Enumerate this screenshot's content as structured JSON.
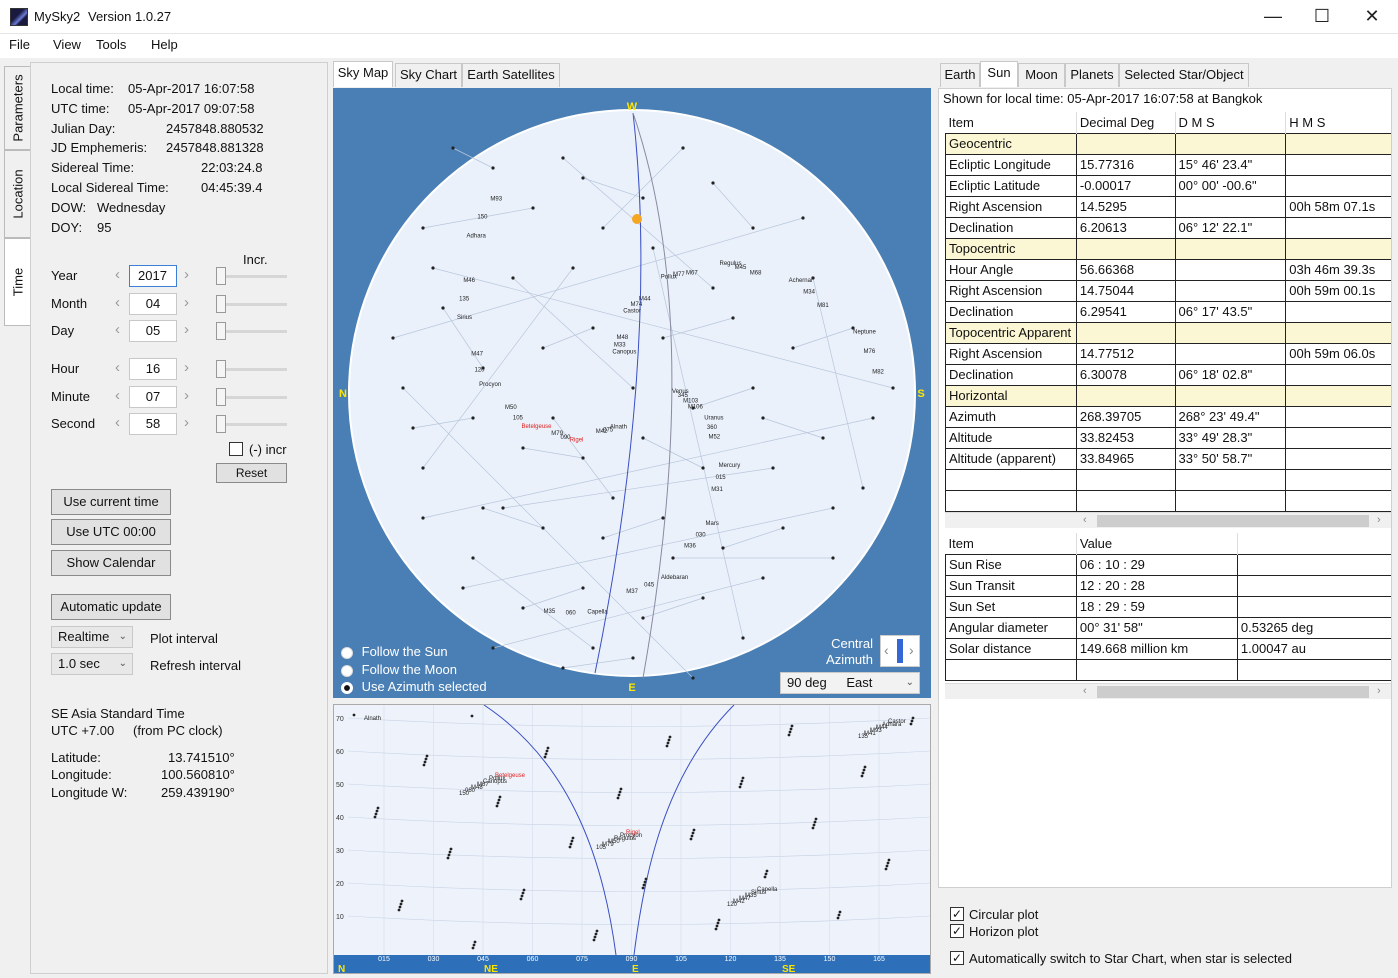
{
  "window": {
    "title": "MySky2",
    "version": "Version 1.0.27",
    "minimize_glyph": "—",
    "maximize_glyph": "☐",
    "close_glyph": "✕"
  },
  "menu": [
    "File",
    "View",
    "Tools",
    "Help"
  ],
  "left_tabs": [
    "Parameters",
    "Location",
    "Time"
  ],
  "time_info": [
    {
      "label": "Local time:",
      "value": "05-Apr-2017   16:07:58"
    },
    {
      "label": "UTC time:",
      "value": "05-Apr-2017   09:07:58"
    },
    {
      "label": "Julian Day:",
      "value": "2457848.880532"
    },
    {
      "label": "JD Emphemeris:",
      "value": "2457848.881328"
    },
    {
      "label": "Sidereal Time:",
      "value": "22:03:24.8"
    },
    {
      "label": "Local Sidereal Time:",
      "value": "04:45:39.4"
    },
    {
      "label": "DOW:",
      "value": "Wednesday"
    },
    {
      "label": "DOY:",
      "value": "95"
    }
  ],
  "incr_label": "Incr.",
  "spinners": [
    {
      "label": "Year",
      "value": "2017"
    },
    {
      "label": "Month",
      "value": "04"
    },
    {
      "label": "Day",
      "value": "05"
    },
    {
      "label": "Hour",
      "value": "16"
    },
    {
      "label": "Minute",
      "value": "07"
    },
    {
      "label": "Second",
      "value": "58"
    }
  ],
  "neg_incr_label": "(-) incr",
  "reset_label": "Reset",
  "buttons": {
    "use_current": "Use current time",
    "use_utc": "Use UTC 00:00",
    "show_calendar": "Show Calendar",
    "automatic_update": "Automatic update"
  },
  "plot_interval": {
    "value": "Realtime",
    "label": "Plot interval"
  },
  "refresh_interval": {
    "value": "1.0 sec",
    "label": "Refresh interval"
  },
  "timezone": {
    "name": "SE Asia Standard Time",
    "offset": "UTC +7.00",
    "source": "(from PC clock)"
  },
  "location": [
    {
      "label": "Latitude:",
      "value": "13.741510°"
    },
    {
      "label": "Longitude:",
      "value": "100.560810°"
    },
    {
      "label": "Longitude W:",
      "value": "259.439190°"
    }
  ],
  "center_tabs": [
    "Sky Map",
    "Sky Chart",
    "Earth Satellites"
  ],
  "skymap": {
    "compass": {
      "top": "W",
      "left": "N",
      "right": "S",
      "bottom": "E"
    },
    "radio_options": [
      "Follow the Sun",
      "Follow the Moon",
      "Use Azimuth selected"
    ],
    "selected_radio": 2,
    "central_azimuth_label": "Central Azimuth",
    "azimuth_value": "90 deg",
    "azimuth_dir": "East",
    "labels": [
      {
        "t": "Venus"
      },
      {
        "t": "Uranus"
      },
      {
        "t": "Mercury"
      },
      {
        "t": "Mars"
      },
      {
        "t": "Aldebaran"
      },
      {
        "t": "Capella"
      },
      {
        "t": "Alnath"
      },
      {
        "t": "Rigel"
      },
      {
        "t": "Betelgeuse"
      },
      {
        "t": "Procyon"
      },
      {
        "t": "Sirius"
      },
      {
        "t": "Adhara"
      },
      {
        "t": "Canopus"
      },
      {
        "t": "Castor"
      },
      {
        "t": "Pollux"
      },
      {
        "t": "Regulus"
      },
      {
        "t": "Achernar"
      },
      {
        "t": "Neptune"
      },
      {
        "t": "345"
      },
      {
        "t": "360"
      },
      {
        "t": "015"
      },
      {
        "t": "030"
      },
      {
        "t": "045"
      },
      {
        "t": "060"
      },
      {
        "t": "075"
      },
      {
        "t": "090"
      },
      {
        "t": "105"
      },
      {
        "t": "120"
      },
      {
        "t": "135"
      },
      {
        "t": "150"
      },
      {
        "t": "M33"
      },
      {
        "t": "M74"
      },
      {
        "t": "M77"
      },
      {
        "t": "M45"
      },
      {
        "t": "M34"
      },
      {
        "t": "M76"
      },
      {
        "t": "M103"
      },
      {
        "t": "M52"
      },
      {
        "t": "M31"
      },
      {
        "t": "M36"
      },
      {
        "t": "M37"
      },
      {
        "t": "M35"
      },
      {
        "t": "M42"
      },
      {
        "t": "M79"
      },
      {
        "t": "M50"
      },
      {
        "t": "M47"
      },
      {
        "t": "M46"
      },
      {
        "t": "M93"
      },
      {
        "t": "M48"
      },
      {
        "t": "M44"
      },
      {
        "t": "M67"
      },
      {
        "t": "M68"
      },
      {
        "t": "M81"
      },
      {
        "t": "M82"
      },
      {
        "t": "M106"
      }
    ],
    "stars": [
      [
        120,
        60
      ],
      [
        160,
        80
      ],
      [
        90,
        140
      ],
      [
        200,
        120
      ],
      [
        250,
        90
      ],
      [
        310,
        110
      ],
      [
        380,
        95
      ],
      [
        420,
        140
      ],
      [
        470,
        130
      ],
      [
        60,
        250
      ],
      [
        110,
        220
      ],
      [
        150,
        280
      ],
      [
        210,
        260
      ],
      [
        260,
        240
      ],
      [
        330,
        250
      ],
      [
        400,
        230
      ],
      [
        460,
        260
      ],
      [
        520,
        240
      ],
      [
        80,
        340
      ],
      [
        140,
        330
      ],
      [
        190,
        360
      ],
      [
        250,
        370
      ],
      [
        310,
        350
      ],
      [
        370,
        380
      ],
      [
        430,
        330
      ],
      [
        490,
        350
      ],
      [
        540,
        330
      ],
      [
        90,
        430
      ],
      [
        150,
        420
      ],
      [
        210,
        440
      ],
      [
        270,
        450
      ],
      [
        330,
        430
      ],
      [
        390,
        460
      ],
      [
        450,
        440
      ],
      [
        500,
        420
      ],
      [
        130,
        500
      ],
      [
        190,
        520
      ],
      [
        250,
        500
      ],
      [
        310,
        530
      ],
      [
        370,
        510
      ],
      [
        430,
        490
      ],
      [
        160,
        560
      ],
      [
        230,
        580
      ],
      [
        300,
        570
      ],
      [
        360,
        590
      ],
      [
        70,
        300
      ],
      [
        560,
        300
      ],
      [
        100,
        180
      ],
      [
        480,
        190
      ],
      [
        530,
        400
      ],
      [
        90,
        380
      ],
      [
        240,
        180
      ],
      [
        180,
        190
      ],
      [
        300,
        300
      ],
      [
        420,
        300
      ],
      [
        360,
        320
      ],
      [
        280,
        410
      ],
      [
        220,
        330
      ],
      [
        170,
        420
      ],
      [
        440,
        380
      ],
      [
        500,
        470
      ],
      [
        340,
        470
      ],
      [
        260,
        560
      ],
      [
        140,
        470
      ],
      [
        410,
        550
      ],
      [
        320,
        160
      ],
      [
        380,
        200
      ],
      [
        230,
        70
      ],
      [
        270,
        140
      ],
      [
        350,
        60
      ]
    ]
  },
  "horizon": {
    "y_ticks": [
      "70",
      "60",
      "50",
      "40",
      "30",
      "20",
      "10"
    ],
    "x_ticks": [
      "015",
      "030",
      "045",
      "060",
      "075",
      "090",
      "105",
      "120",
      "135",
      "150",
      "165"
    ],
    "dir_labels": [
      "N",
      "NE",
      "E",
      "SE"
    ],
    "labels": [
      {
        "t": "Alnath"
      },
      {
        "t": "Betelgeuse"
      },
      {
        "t": "Rigel"
      },
      {
        "t": "Capella"
      },
      {
        "t": "Castor"
      },
      {
        "t": "Pollux"
      },
      {
        "t": "Procyon"
      },
      {
        "t": "Sirius"
      },
      {
        "t": "Adhara"
      },
      {
        "t": "Canopus"
      },
      {
        "t": "Regulus"
      },
      {
        "t": "M35"
      },
      {
        "t": "M44"
      },
      {
        "t": "M67"
      },
      {
        "t": "M50"
      },
      {
        "t": "M47"
      },
      {
        "t": "M93"
      },
      {
        "t": "M48"
      },
      {
        "t": "M79"
      },
      {
        "t": "M42"
      },
      {
        "t": "M41"
      },
      {
        "t": "060"
      },
      {
        "t": "105"
      },
      {
        "t": "120"
      },
      {
        "t": "135"
      },
      {
        "t": "150"
      }
    ]
  },
  "right_tabs": [
    "Earth",
    "Sun",
    "Moon",
    "Planets",
    "Selected Star/Object"
  ],
  "shown_for": "Shown for local time: 05-Apr-2017 16:07:58 at Bangkok",
  "sun_table": {
    "headers": [
      "Item",
      "Decimal Deg",
      "D M S",
      "H M S"
    ],
    "rows": [
      {
        "section": true,
        "cells": [
          "Geocentric",
          "",
          "",
          ""
        ]
      },
      {
        "cells": [
          "Ecliptic Longitude",
          "15.77316",
          "15° 46' 23.4\"",
          ""
        ]
      },
      {
        "cells": [
          "Ecliptic Latitude",
          "-0.00017",
          "00° 00' -00.6\"",
          ""
        ]
      },
      {
        "cells": [
          "Right Ascension",
          "14.5295",
          "",
          "00h 58m 07.1s"
        ]
      },
      {
        "cells": [
          "Declination",
          "6.20613",
          "06° 12' 22.1\"",
          ""
        ]
      },
      {
        "section": true,
        "cells": [
          "Topocentric",
          "",
          "",
          ""
        ]
      },
      {
        "cells": [
          "Hour Angle",
          "56.66368",
          "",
          "03h 46m 39.3s"
        ]
      },
      {
        "cells": [
          "Right Ascension",
          "14.75044",
          "",
          "00h 59m 00.1s"
        ]
      },
      {
        "cells": [
          "Declination",
          "6.29541",
          "06° 17' 43.5\"",
          ""
        ]
      },
      {
        "section": true,
        "cells": [
          "Topocentric Apparent",
          "",
          "",
          ""
        ]
      },
      {
        "cells": [
          "Right Ascension",
          "14.77512",
          "",
          "00h 59m 06.0s"
        ]
      },
      {
        "cells": [
          "Declination",
          "6.30078",
          "06° 18' 02.8\"",
          ""
        ]
      },
      {
        "section": true,
        "cells": [
          "Horizontal",
          "",
          "",
          ""
        ]
      },
      {
        "cells": [
          "Azimuth",
          "268.39705",
          "268° 23' 49.4\"",
          ""
        ]
      },
      {
        "cells": [
          "Altitude",
          "33.82453",
          "33° 49' 28.3\"",
          ""
        ]
      },
      {
        "cells": [
          "Altitude (apparent)",
          "33.84965",
          "33° 50' 58.7\"",
          ""
        ]
      },
      {
        "cells": [
          "",
          "",
          "",
          ""
        ]
      },
      {
        "cells": [
          "",
          "",
          "",
          ""
        ]
      }
    ]
  },
  "sun_events": {
    "headers": [
      "Item",
      "Value"
    ],
    "rows": [
      [
        "Sun Rise",
        "06 : 10 : 29",
        ""
      ],
      [
        "Sun Transit",
        "12 : 20 : 28",
        ""
      ],
      [
        "Sun Set",
        "18 : 29 : 59",
        ""
      ],
      [
        "Angular diameter",
        "00° 31' 58\"",
        "0.53265 deg"
      ],
      [
        "Solar distance",
        "149.668 million km",
        "1.00047 au"
      ],
      [
        "",
        "",
        ""
      ]
    ]
  },
  "options": [
    {
      "label": "Circular plot",
      "checked": true
    },
    {
      "label": "Horizon plot",
      "checked": true
    },
    {
      "label": "Automatically switch to Star Chart, when star is selected",
      "checked": true
    }
  ]
}
